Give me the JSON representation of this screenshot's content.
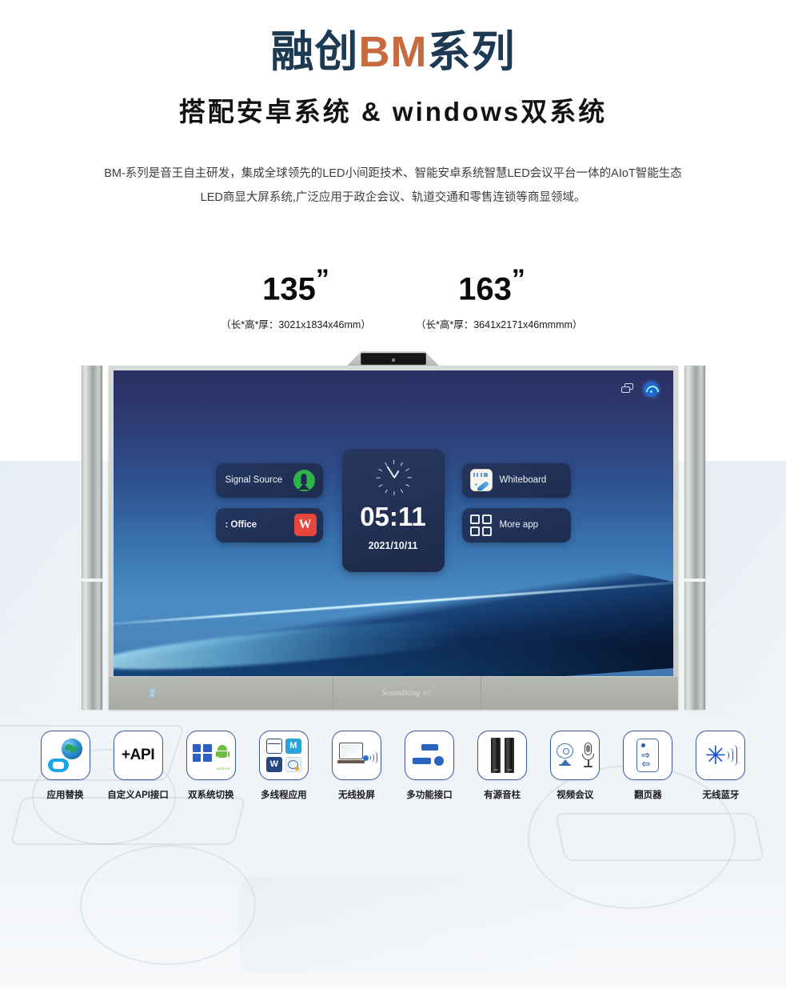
{
  "header": {
    "title_prefix": "融创",
    "title_accent": "BM",
    "title_suffix": "系列",
    "subtitle": "搭配安卓系统 & windows双系统",
    "description": "BM-系列是音王自主研发，集成全球领先的LED小间距技术、智能安卓系统智慧LED会议平台一体的AIoT智能生态LED商显大屏系统,广泛应用于政企会议、轨道交通和零售连锁等商显领域。",
    "accent_color": "#c96a3f",
    "title_color": "#1e3a52"
  },
  "sizes": [
    {
      "inches": "135",
      "quote": "”",
      "dimensions": "（长*高*厚：3021x1834x46mm）"
    },
    {
      "inches": "163",
      "quote": "”",
      "dimensions": "（长*高*厚：3641x2171x46mmmm）"
    }
  ],
  "device": {
    "status_icons": [
      {
        "name": "screen-cast-icon",
        "label": "cast"
      },
      {
        "name": "wifi-icon",
        "label": "wifi"
      }
    ],
    "brand": {
      "word": "Soundking",
      "cn": "音王"
    },
    "screen": {
      "clock": {
        "time": "05:11",
        "date": "2021/10/11"
      },
      "cards": [
        {
          "id": "signal-source",
          "label": "Signal Source",
          "icon": "signal-source-icon"
        },
        {
          "id": "office",
          "label": ": Office",
          "icon": "wps-office-icon",
          "icon_letter": "W"
        },
        {
          "id": "whiteboard",
          "label": "Whiteboard",
          "icon": "whiteboard-icon"
        },
        {
          "id": "more-app",
          "label": "More app",
          "icon": "grid-apps-icon"
        }
      ]
    }
  },
  "features": [
    {
      "id": "app-replace",
      "label": "应用替换",
      "icon": "globe-folder-icon"
    },
    {
      "id": "custom-api",
      "label": "自定义API接口",
      "icon": "plus-api-icon",
      "text": "+API"
    },
    {
      "id": "dual-system",
      "label": "双系统切换",
      "icon": "windows-android-icon",
      "android_word": "android"
    },
    {
      "id": "multi-thread",
      "label": "多线程应用",
      "icon": "multi-app-icon",
      "tiles": [
        "",
        "M",
        "W",
        ""
      ]
    },
    {
      "id": "wireless-cast",
      "label": "无线投屏",
      "icon": "laptop-cast-icon"
    },
    {
      "id": "multi-port",
      "label": "多功能接口",
      "icon": "ports-icon"
    },
    {
      "id": "active-speaker",
      "label": "有源音柱",
      "icon": "speaker-column-icon"
    },
    {
      "id": "video-conf",
      "label": "视频会议",
      "icon": "camera-mic-icon"
    },
    {
      "id": "page-turner",
      "label": "翻页器",
      "icon": "clicker-icon",
      "arrows": [
        "⇨",
        "⇦"
      ]
    },
    {
      "id": "bluetooth",
      "label": "无线蓝牙",
      "icon": "bluetooth-icon",
      "symbol": "✳"
    }
  ]
}
